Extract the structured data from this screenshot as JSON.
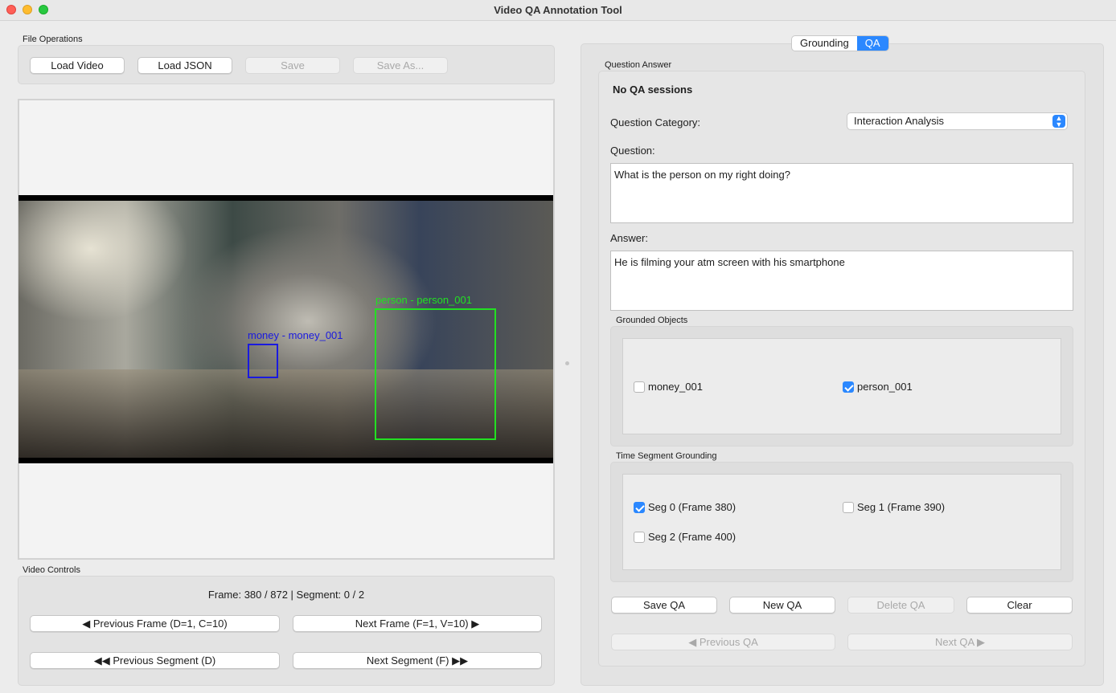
{
  "window": {
    "title": "Video QA Annotation Tool"
  },
  "file_ops": {
    "label": "File Operations",
    "load_video": "Load Video",
    "load_json": "Load JSON",
    "save": "Save",
    "save_as": "Save As..."
  },
  "video": {
    "boxes": [
      {
        "label": "money - money_001",
        "color": "#1a1adf"
      },
      {
        "label": "person - person_001",
        "color": "#22e022"
      }
    ]
  },
  "controls": {
    "label": "Video Controls",
    "status": "Frame: 380 / 872 | Segment: 0 / 2",
    "prev_frame": "◀ Previous Frame (D=1, C=10)",
    "next_frame": "Next Frame (F=1, V=10) ▶",
    "prev_segment": "◀◀ Previous Segment (D)",
    "next_segment": "Next Segment (F) ▶▶"
  },
  "tabs": [
    {
      "label": "Grounding",
      "active": false
    },
    {
      "label": "QA",
      "active": true
    }
  ],
  "qa": {
    "group_label": "Question  Answer",
    "session_status": "No QA sessions",
    "category_label": "Question Category:",
    "category_value": "Interaction Analysis",
    "question_label": "Question:",
    "question_value": "What is the person on my right doing?",
    "answer_label": "Answer:",
    "answer_value": "He is filming your atm screen with his smartphone",
    "grounded_label": "Grounded Objects",
    "grounded_objects": [
      {
        "label": "money_001",
        "checked": false
      },
      {
        "label": "person_001",
        "checked": true
      }
    ],
    "segment_label": "Time Segment Grounding",
    "segments": [
      {
        "label": "Seg 0 (Frame 380)",
        "checked": true
      },
      {
        "label": "Seg 1 (Frame 390)",
        "checked": false
      },
      {
        "label": "Seg 2 (Frame 400)",
        "checked": false
      }
    ],
    "save_qa": "Save QA",
    "new_qa": "New QA",
    "delete_qa": "Delete QA",
    "clear": "Clear",
    "prev_qa": "◀ Previous QA",
    "next_qa": "Next QA ▶"
  },
  "colors": {
    "accent": "#2b88ff"
  }
}
